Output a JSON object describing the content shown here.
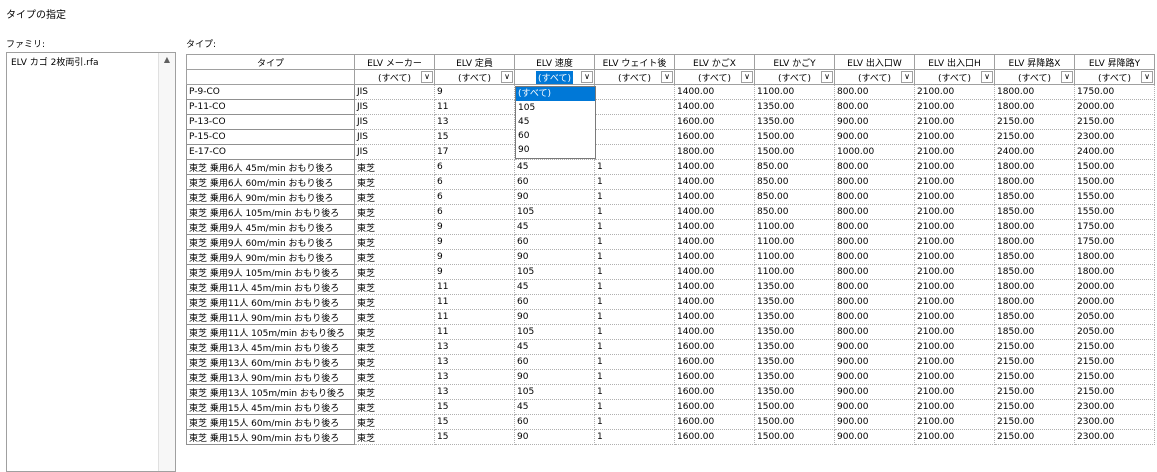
{
  "window": {
    "title": "タイプの指定"
  },
  "family": {
    "label": "ファミリ:",
    "items": [
      "ELV カゴ 2枚両引.rfa"
    ]
  },
  "types": {
    "label": "タイプ:"
  },
  "grid": {
    "columns": [
      "タイプ",
      "ELV メーカー",
      "ELV 定員",
      "ELV 速度",
      "ELV ウェイト後",
      "ELV かごX",
      "ELV かごY",
      "ELV 出入口W",
      "ELV 出入口H",
      "ELV 昇降路X",
      "ELV 昇降路Y"
    ],
    "filters": [
      "",
      "(すべて)",
      "(すべて)",
      "(すべて)",
      "(すべて)",
      "(すべて)",
      "(すべて)",
      "(すべて)",
      "(すべて)",
      "(すべて)",
      "(すべて)"
    ],
    "rows": [
      [
        "P-9-CO",
        "JIS",
        "9",
        "",
        "",
        "1400.00",
        "1100.00",
        "800.00",
        "2100.00",
        "1800.00",
        "1750.00"
      ],
      [
        "P-11-CO",
        "JIS",
        "11",
        "",
        "",
        "1400.00",
        "1350.00",
        "800.00",
        "2100.00",
        "1800.00",
        "2000.00"
      ],
      [
        "P-13-CO",
        "JIS",
        "13",
        "",
        "",
        "1600.00",
        "1350.00",
        "900.00",
        "2100.00",
        "2150.00",
        "2150.00"
      ],
      [
        "P-15-CO",
        "JIS",
        "15",
        "",
        "",
        "1600.00",
        "1500.00",
        "900.00",
        "2100.00",
        "2150.00",
        "2300.00"
      ],
      [
        "E-17-CO",
        "JIS",
        "17",
        "",
        "",
        "1800.00",
        "1500.00",
        "1000.00",
        "2100.00",
        "2400.00",
        "2400.00"
      ],
      [
        "東芝 乗用6人 45m/min おもり後ろ",
        "東芝",
        "6",
        "45",
        "1",
        "1400.00",
        "850.00",
        "800.00",
        "2100.00",
        "1800.00",
        "1500.00"
      ],
      [
        "東芝 乗用6人 60m/min おもり後ろ",
        "東芝",
        "6",
        "60",
        "1",
        "1400.00",
        "850.00",
        "800.00",
        "2100.00",
        "1800.00",
        "1500.00"
      ],
      [
        "東芝 乗用6人 90m/min おもり後ろ",
        "東芝",
        "6",
        "90",
        "1",
        "1400.00",
        "850.00",
        "800.00",
        "2100.00",
        "1850.00",
        "1550.00"
      ],
      [
        "東芝 乗用6人 105m/min おもり後ろ",
        "東芝",
        "6",
        "105",
        "1",
        "1400.00",
        "850.00",
        "800.00",
        "2100.00",
        "1850.00",
        "1550.00"
      ],
      [
        "東芝 乗用9人 45m/min おもり後ろ",
        "東芝",
        "9",
        "45",
        "1",
        "1400.00",
        "1100.00",
        "800.00",
        "2100.00",
        "1800.00",
        "1750.00"
      ],
      [
        "東芝 乗用9人 60m/min おもり後ろ",
        "東芝",
        "9",
        "60",
        "1",
        "1400.00",
        "1100.00",
        "800.00",
        "2100.00",
        "1800.00",
        "1750.00"
      ],
      [
        "東芝 乗用9人 90m/min おもり後ろ",
        "東芝",
        "9",
        "90",
        "1",
        "1400.00",
        "1100.00",
        "800.00",
        "2100.00",
        "1850.00",
        "1800.00"
      ],
      [
        "東芝 乗用9人 105m/min おもり後ろ",
        "東芝",
        "9",
        "105",
        "1",
        "1400.00",
        "1100.00",
        "800.00",
        "2100.00",
        "1850.00",
        "1800.00"
      ],
      [
        "東芝 乗用11人 45m/min おもり後ろ",
        "東芝",
        "11",
        "45",
        "1",
        "1400.00",
        "1350.00",
        "800.00",
        "2100.00",
        "1800.00",
        "2000.00"
      ],
      [
        "東芝 乗用11人 60m/min おもり後ろ",
        "東芝",
        "11",
        "60",
        "1",
        "1400.00",
        "1350.00",
        "800.00",
        "2100.00",
        "1800.00",
        "2000.00"
      ],
      [
        "東芝 乗用11人 90m/min おもり後ろ",
        "東芝",
        "11",
        "90",
        "1",
        "1400.00",
        "1350.00",
        "800.00",
        "2100.00",
        "1850.00",
        "2050.00"
      ],
      [
        "東芝 乗用11人 105m/min おもり後ろ",
        "東芝",
        "11",
        "105",
        "1",
        "1400.00",
        "1350.00",
        "800.00",
        "2100.00",
        "1850.00",
        "2050.00"
      ],
      [
        "東芝 乗用13人 45m/min おもり後ろ",
        "東芝",
        "13",
        "45",
        "1",
        "1600.00",
        "1350.00",
        "900.00",
        "2100.00",
        "2150.00",
        "2150.00"
      ],
      [
        "東芝 乗用13人 60m/min おもり後ろ",
        "東芝",
        "13",
        "60",
        "1",
        "1600.00",
        "1350.00",
        "900.00",
        "2100.00",
        "2150.00",
        "2150.00"
      ],
      [
        "東芝 乗用13人 90m/min おもり後ろ",
        "東芝",
        "13",
        "90",
        "1",
        "1600.00",
        "1350.00",
        "900.00",
        "2100.00",
        "2150.00",
        "2150.00"
      ],
      [
        "東芝 乗用13人 105m/min おもり後ろ",
        "東芝",
        "13",
        "105",
        "1",
        "1600.00",
        "1350.00",
        "900.00",
        "2100.00",
        "2150.00",
        "2150.00"
      ],
      [
        "東芝 乗用15人 45m/min おもり後ろ",
        "東芝",
        "15",
        "45",
        "1",
        "1600.00",
        "1500.00",
        "900.00",
        "2100.00",
        "2150.00",
        "2300.00"
      ],
      [
        "東芝 乗用15人 60m/min おもり後ろ",
        "東芝",
        "15",
        "60",
        "1",
        "1600.00",
        "1500.00",
        "900.00",
        "2100.00",
        "2150.00",
        "2300.00"
      ],
      [
        "東芝 乗用15人 90m/min おもり後ろ",
        "東芝",
        "15",
        "90",
        "1",
        "1600.00",
        "1500.00",
        "900.00",
        "2100.00",
        "2150.00",
        "2300.00"
      ]
    ]
  },
  "speed_filter_popup": {
    "options": [
      "(すべて)",
      "105",
      "45",
      "60",
      "90"
    ],
    "highlighted": "(すべて)"
  },
  "colors": {
    "selection": "#0078d7"
  }
}
